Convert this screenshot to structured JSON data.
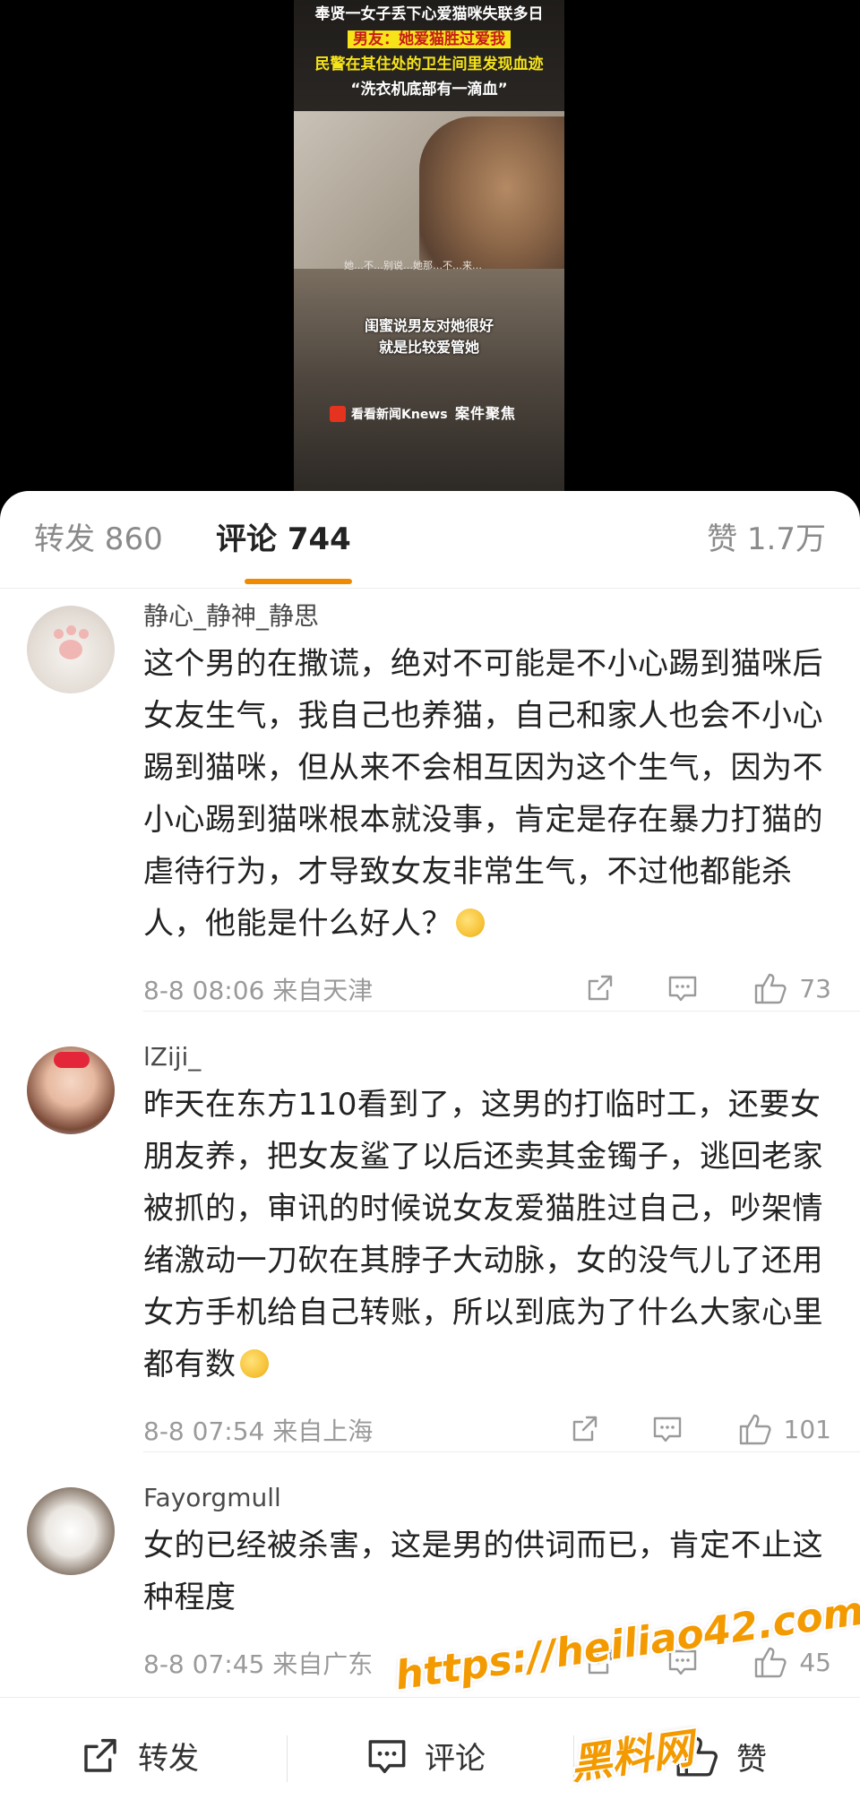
{
  "video": {
    "headline": [
      "奉贤一女子丢下心爱猫咪失联多日",
      "男友：她爱猫胜过爱我",
      "民警在其住处的卫生间里发现血迹",
      "“洗衣机底部有一滴血”"
    ],
    "small_caption": "她…不…别说…她那…不…来…",
    "subtitle": [
      "闺蜜说男友对她很好",
      "就是比较爱管她"
    ],
    "logo_text": "看看新闻Knews",
    "brand_text": "案件聚焦"
  },
  "tabs": {
    "repost": "转发 860",
    "comments": "评论 744",
    "likes": "赞 1.7万"
  },
  "comments": [
    {
      "username": "静心_静神_静思",
      "text": "这个男的在撒谎，绝对不可能是不小心踢到猫咪后女友生气，我自己也养猫，自己和家人也会不小心踢到猫咪，但从来不会相互因为这个生气，因为不小心踢到猫咪根本就没事，肯定是存在暴力打猫的虐待行为，才导致女友非常生气，不过他都能杀人，他能是什么好人？",
      "meta": "8-8 08:06  来自天津",
      "likes": "73"
    },
    {
      "username": "lZiji_",
      "text": "昨天在东方110看到了，这男的打临时工，还要女朋友养，把女友鲨了以后还卖其金镯子，逃回老家被抓的，审讯的时候说女友爱猫胜过自己，吵架情绪激动一刀砍在其脖子大动脉，女的没气儿了还用女方手机给自己转账，所以到底为了什么大家心里都有数",
      "meta": "8-8 07:54  来自上海",
      "likes": "101"
    },
    {
      "username": "Fayorgmull",
      "text": "女的已经被杀害，这是男的供词而已，肯定不止这种程度",
      "meta": "8-8 07:45  来自广东",
      "likes": "45"
    }
  ],
  "bottom_bar": {
    "repost": "转发",
    "comment": "评论",
    "like": "赞"
  },
  "watermark": {
    "url": "https://heiliao42.com",
    "name": "黑料网"
  },
  "colors": {
    "accent": "#f08a00",
    "text": "#222222",
    "muted": "#9a9a9a"
  }
}
